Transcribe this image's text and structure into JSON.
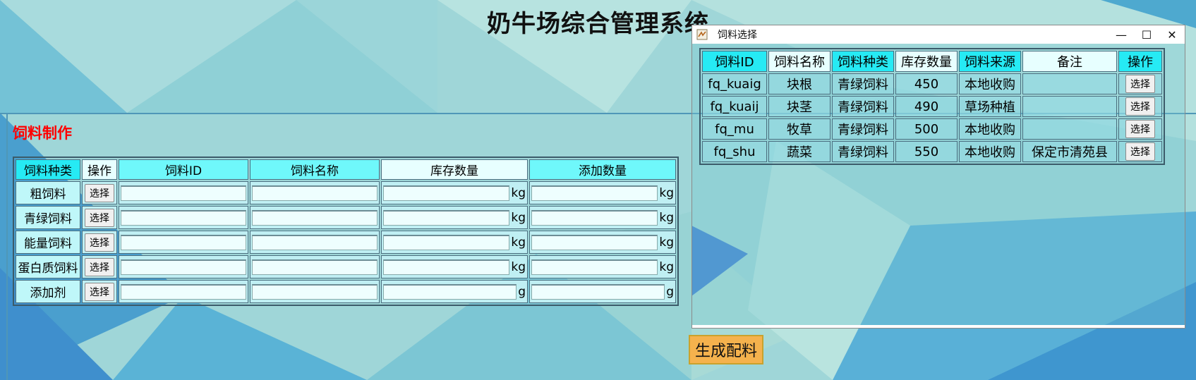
{
  "app": {
    "title": "奶牛场综合管理系统"
  },
  "feed_make": {
    "section_title": "饲料制作",
    "headers": [
      "饲料种类",
      "操作",
      "饲料ID",
      "饲料名称",
      "库存数量",
      "添加数量"
    ],
    "rows": [
      {
        "category": "粗饲料",
        "button": "选择",
        "unit1": "kg",
        "unit2": "kg"
      },
      {
        "category": "青绿饲料",
        "button": "选择",
        "unit1": "kg",
        "unit2": "kg"
      },
      {
        "category": "能量饲料",
        "button": "选择",
        "unit1": "kg",
        "unit2": "kg"
      },
      {
        "category": "蛋白质饲料",
        "button": "选择",
        "unit1": "kg",
        "unit2": "kg"
      },
      {
        "category": "添加剂",
        "button": "选择",
        "unit1": "g",
        "unit2": "g"
      }
    ]
  },
  "dialog": {
    "title": "饲料选择",
    "controls": {
      "minimize": "—",
      "maximize": "☐",
      "close": "✕"
    },
    "headers": [
      "饲料ID",
      "饲料名称",
      "饲料种类",
      "库存数量",
      "饲料来源",
      "备注",
      "操作"
    ],
    "rows": [
      {
        "id": "fq_kuaig",
        "name": "块根",
        "type": "青绿饲料",
        "stock": "450",
        "source": "本地收购",
        "note": "",
        "button": "选择"
      },
      {
        "id": "fq_kuaij",
        "name": "块茎",
        "type": "青绿饲料",
        "stock": "490",
        "source": "草场种植",
        "note": "",
        "button": "选择"
      },
      {
        "id": "fq_mu",
        "name": "牧草",
        "type": "青绿饲料",
        "stock": "500",
        "source": "本地收购",
        "note": "",
        "button": "选择"
      },
      {
        "id": "fq_shu",
        "name": "蔬菜",
        "type": "青绿饲料",
        "stock": "550",
        "source": "本地收购",
        "note": "保定市清苑县",
        "button": "选择"
      }
    ]
  },
  "generate_button": "生成配料"
}
